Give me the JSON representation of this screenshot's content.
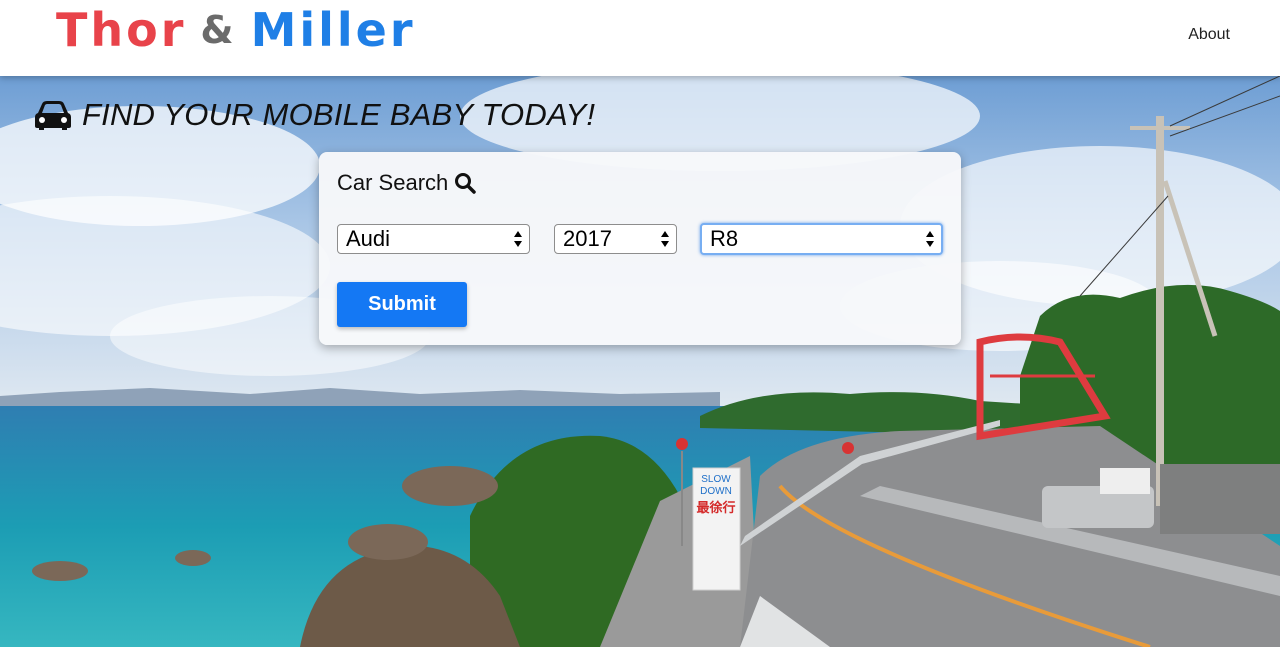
{
  "brand": {
    "word1": "Thor",
    "amp": "&",
    "word2": "Miller"
  },
  "nav": {
    "about": "About"
  },
  "hero": {
    "tagline": "FIND YOUR MOBILE BABY TODAY!"
  },
  "search": {
    "title": "Car Search",
    "make": "Audi",
    "year": "2017",
    "model": "R8",
    "submit": "Submit"
  },
  "sign": {
    "line1": "SLOW",
    "line2": "DOWN",
    "kanji": "最徐行"
  },
  "icons": {
    "car": "car-icon",
    "search": "search-icon"
  },
  "colors": {
    "accent": "#1478f4",
    "logo_red": "#e8434a",
    "logo_blue": "#1f7fe6"
  }
}
